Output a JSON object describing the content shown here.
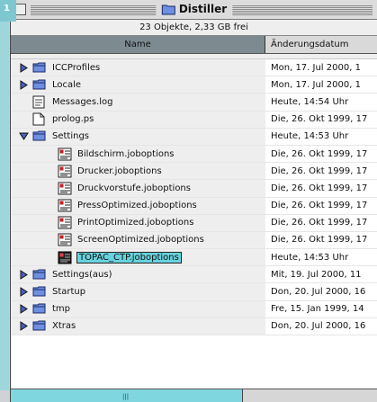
{
  "badge": "1",
  "window": {
    "title": "Distiller"
  },
  "info": "23 Objekte, 2,33 GB frei",
  "columns": {
    "name": "Name",
    "date": "Änderungsdatum"
  },
  "rows": [
    {
      "name": "ICCProfiles",
      "date": "Mon, 17. Jul 2000, 1",
      "kind": "folder",
      "expander": "collapsed",
      "indent": 0,
      "selected": false
    },
    {
      "name": "Locale",
      "date": "Mon, 17. Jul 2000, 1",
      "kind": "folder",
      "expander": "collapsed",
      "indent": 0,
      "selected": false
    },
    {
      "name": "Messages.log",
      "date": "Heute, 14:54 Uhr",
      "kind": "textdoc",
      "expander": "none",
      "indent": 0,
      "selected": false
    },
    {
      "name": "prolog.ps",
      "date": "Die, 26. Okt 1999, 17",
      "kind": "doc",
      "expander": "none",
      "indent": 0,
      "selected": false
    },
    {
      "name": "Settings",
      "date": "Heute, 14:53 Uhr",
      "kind": "folder",
      "expander": "expanded",
      "indent": 0,
      "selected": false
    },
    {
      "name": "Bildschirm.joboptions",
      "date": "Die, 26. Okt 1999, 17",
      "kind": "joboptions",
      "expander": "none",
      "indent": 1,
      "selected": false
    },
    {
      "name": "Drucker.joboptions",
      "date": "Die, 26. Okt 1999, 17",
      "kind": "joboptions",
      "expander": "none",
      "indent": 1,
      "selected": false
    },
    {
      "name": "Druckvorstufe.joboptions",
      "date": "Die, 26. Okt 1999, 17",
      "kind": "joboptions",
      "expander": "none",
      "indent": 1,
      "selected": false
    },
    {
      "name": "PressOptimized.joboptions",
      "date": "Die, 26. Okt 1999, 17",
      "kind": "joboptions",
      "expander": "none",
      "indent": 1,
      "selected": false
    },
    {
      "name": "PrintOptimized.joboptions",
      "date": "Die, 26. Okt 1999, 17",
      "kind": "joboptions",
      "expander": "none",
      "indent": 1,
      "selected": false
    },
    {
      "name": "ScreenOptimized.joboptions",
      "date": "Die, 26. Okt 1999, 17",
      "kind": "joboptions",
      "expander": "none",
      "indent": 1,
      "selected": false
    },
    {
      "name": "TOPAC_CTP.joboptions",
      "date": "Heute, 14:53 Uhr",
      "kind": "joboptions-dark",
      "expander": "none",
      "indent": 1,
      "selected": true
    },
    {
      "name": "Settings(aus)",
      "date": "Mit, 19. Jul 2000, 11",
      "kind": "folder",
      "expander": "collapsed",
      "indent": 0,
      "selected": false
    },
    {
      "name": "Startup",
      "date": "Don, 20. Jul 2000, 16",
      "kind": "folder",
      "expander": "collapsed",
      "indent": 0,
      "selected": false
    },
    {
      "name": "tmp",
      "date": "Fre, 15. Jan 1999, 14",
      "kind": "folder",
      "expander": "collapsed",
      "indent": 0,
      "selected": false
    },
    {
      "name": "Xtras",
      "date": "Don, 20. Jul 2000, 16",
      "kind": "folder",
      "expander": "collapsed",
      "indent": 0,
      "selected": false
    }
  ],
  "colors": {
    "selection": "#67d3dd",
    "name_header": "#7d8b91",
    "scrollbar": "#7fd6df"
  }
}
